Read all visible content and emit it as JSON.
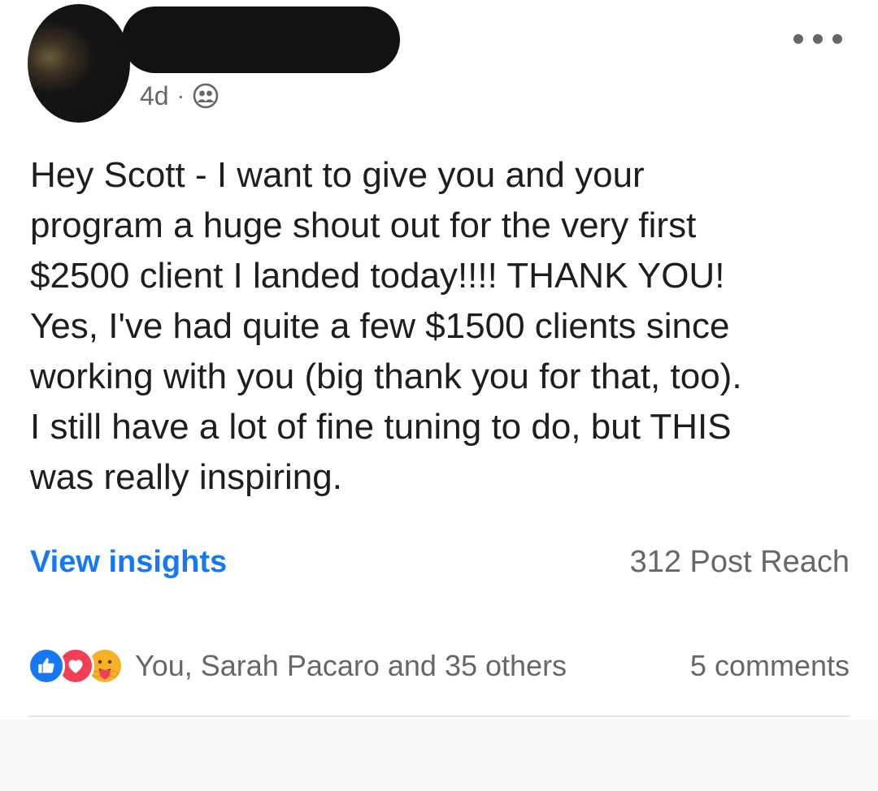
{
  "post": {
    "time": "4d",
    "separator": "·",
    "audience_icon": "friends-icon",
    "more_icon": "more-horizontal-icon",
    "lines": [
      "Hey Scott - I want to give you and your",
      "program a huge shout out for the very first",
      "$2500 client I landed today!!!! THANK YOU!",
      "Yes, I've had quite a few $1500 clients since",
      "working with you (big thank you for that, too).",
      "I still have a lot of fine tuning to do, but THIS",
      "was really inspiring."
    ]
  },
  "insights": {
    "link": "View insights",
    "reach": "312 Post Reach"
  },
  "reactions": {
    "icons": [
      "like-icon",
      "love-icon",
      "care-icon"
    ],
    "summary": "You, Sarah Pacaro and 35 others",
    "comments": "5 comments"
  },
  "colors": {
    "link": "#1877f2",
    "secondary_text": "#65676b",
    "like": "#1877f2",
    "love": "#f33e58",
    "care": "#f7b125"
  }
}
